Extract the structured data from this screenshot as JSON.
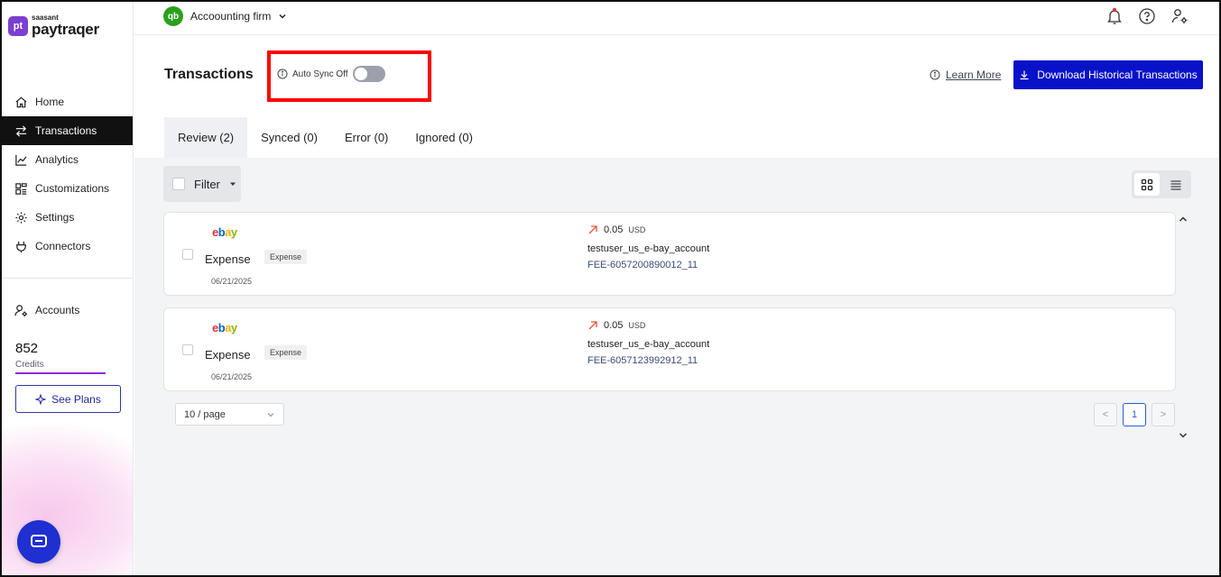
{
  "brand": {
    "small": "saasant",
    "name": "paytraqer",
    "logo_text": "pt"
  },
  "nav": {
    "items": [
      {
        "label": "Home",
        "icon": "home-icon"
      },
      {
        "label": "Transactions",
        "icon": "transfer-icon",
        "active": true
      },
      {
        "label": "Analytics",
        "icon": "chart-icon"
      },
      {
        "label": "Customizations",
        "icon": "grid-icon"
      },
      {
        "label": "Settings",
        "icon": "gear-icon"
      },
      {
        "label": "Connectors",
        "icon": "plug-icon"
      }
    ],
    "accounts": "Accounts"
  },
  "credits": {
    "value": "852",
    "label": "Credits",
    "see_plans": "See Plans"
  },
  "header": {
    "company": "Accoounting firm",
    "qb_logo": "qb"
  },
  "page": {
    "title": "Transactions",
    "auto_sync_label": "Auto Sync Off",
    "learn_more": "Learn More",
    "download": "Download Historical Transactions"
  },
  "tabs": [
    "Review (2)",
    "Synced (0)",
    "Error (0)",
    "Ignored (0)"
  ],
  "filter": {
    "label": "Filter"
  },
  "transactions": [
    {
      "source": "ebay",
      "type": "Expense",
      "tag": "Expense",
      "date": "06/21/2025",
      "amount": "0.05",
      "currency": "USD",
      "account": "testuser_us_e-bay_account",
      "reference": "FEE-6057200890012_11"
    },
    {
      "source": "ebay",
      "type": "Expense",
      "tag": "Expense",
      "date": "06/21/2025",
      "amount": "0.05",
      "currency": "USD",
      "account": "testuser_us_e-bay_account",
      "reference": "FEE-6057123992912_11"
    }
  ],
  "pagination": {
    "page_size": "10 / page",
    "current": "1",
    "prev": "<",
    "next": ">"
  },
  "colors": {
    "accent": "#0a12c9",
    "brand": "#7b3fd1",
    "highlight": "#ff0000"
  }
}
